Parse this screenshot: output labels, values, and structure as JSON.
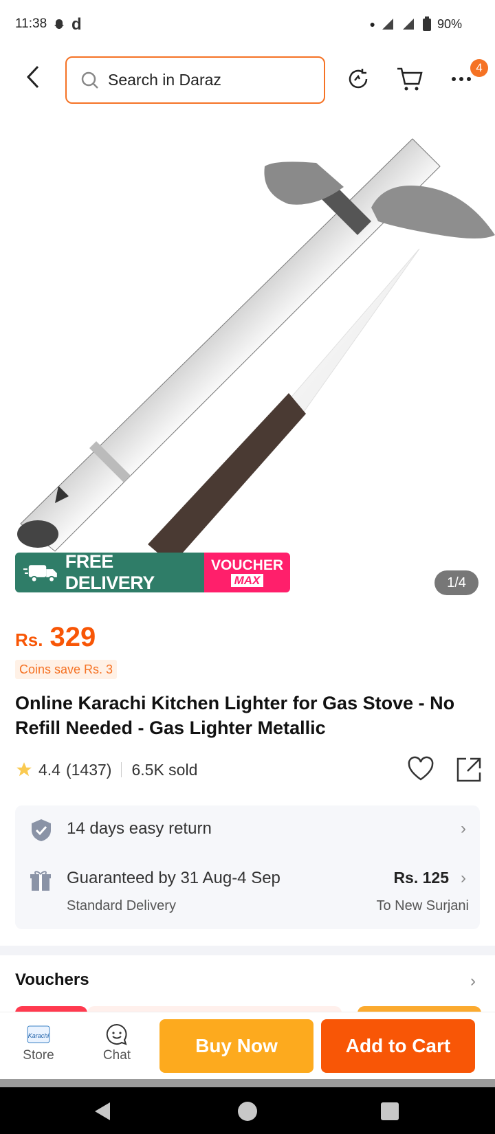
{
  "status_bar": {
    "time": "11:38",
    "app_letter": "d",
    "battery": "90%"
  },
  "header": {
    "search_placeholder": "Search in Daraz",
    "cart_badge": "4"
  },
  "product": {
    "promo_free_label": "FREE DELIVERY",
    "promo_free_tag": "FREE",
    "promo_voucher_top": "VOUCHER",
    "promo_voucher_bottom": "MAX",
    "image_counter": "1/4",
    "price_currency": "Rs.",
    "price_amount": "329",
    "coins_text": "Coins save Rs. 3",
    "title": "Online Karachi Kitchen Lighter for Gas Stove - No Refill Needed - Gas Lighter Metallic",
    "rating": "4.4",
    "rating_count": "(1437)",
    "sold": "6.5K sold"
  },
  "delivery": {
    "return_text": "14 days easy return",
    "guarantee_text": "Guaranteed by 31 Aug-4 Sep",
    "delivery_type": "Standard Delivery",
    "delivery_price": "Rs. 125",
    "destination": "To New Surjani"
  },
  "sections": {
    "vouchers_title": "Vouchers"
  },
  "bottom_bar": {
    "store_label": "Store",
    "store_logo_text": "Karachi",
    "chat_label": "Chat",
    "buy_now": "Buy Now",
    "add_to_cart": "Add to Cart"
  },
  "colors": {
    "accent": "#f85606",
    "buy_now": "#fdaa1e",
    "free_delivery": "#2f7d68",
    "voucher_max": "#ff1f6b"
  }
}
